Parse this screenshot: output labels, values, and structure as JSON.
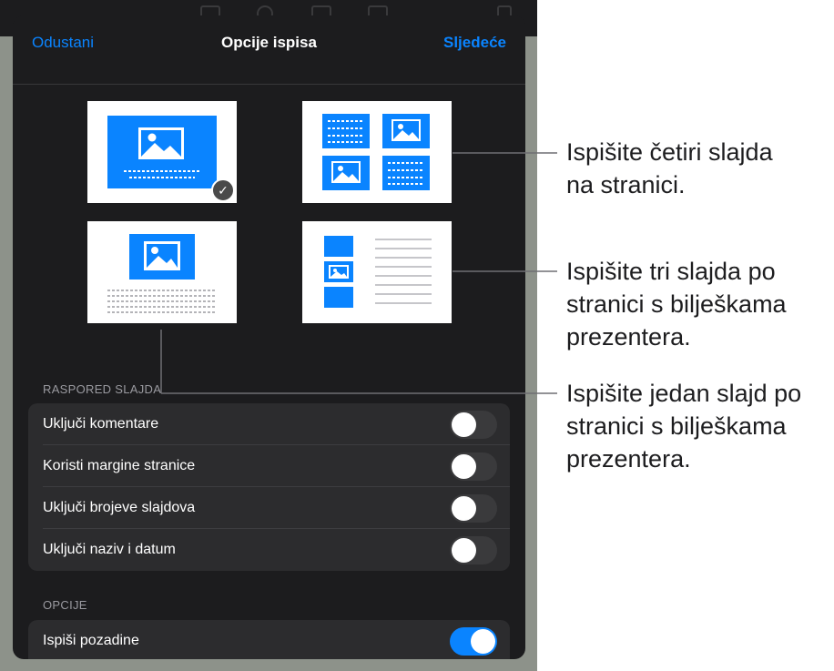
{
  "header": {
    "cancel_label": "Odustani",
    "title": "Opcije ispisa",
    "next_label": "Sljedeće"
  },
  "layouts": [
    {
      "name": "one-slide",
      "selected": true
    },
    {
      "name": "four-slides",
      "selected": false
    },
    {
      "name": "one-slide-with-notes",
      "selected": false
    },
    {
      "name": "three-slides-with-notes",
      "selected": false
    }
  ],
  "sections": {
    "layout_header": "RASPORED SLAJDA",
    "options_header": "OPCIJE"
  },
  "layout_options": [
    {
      "label": "Uključi komentare",
      "on": false
    },
    {
      "label": "Koristi margine stranice",
      "on": false
    },
    {
      "label": "Uključi brojeve slajdova",
      "on": false
    },
    {
      "label": "Uključi naziv i datum",
      "on": false
    }
  ],
  "options": [
    {
      "label": "Ispiši pozadine",
      "on": true
    }
  ],
  "callouts": {
    "four_slides": [
      "Ispišite četiri slajda",
      "na stranici."
    ],
    "three_slides": [
      "Ispišite tri slajda po",
      "stranici s bilješkama",
      "prezentera."
    ],
    "one_slide": [
      "Ispišite jedan slajd po",
      "stranici s bilješkama",
      "prezentera."
    ]
  },
  "colors": {
    "accent": "#0a84ff",
    "slide_blue": "#0a84ff",
    "panel": "#1c1c1e",
    "group": "#2c2c2e"
  }
}
